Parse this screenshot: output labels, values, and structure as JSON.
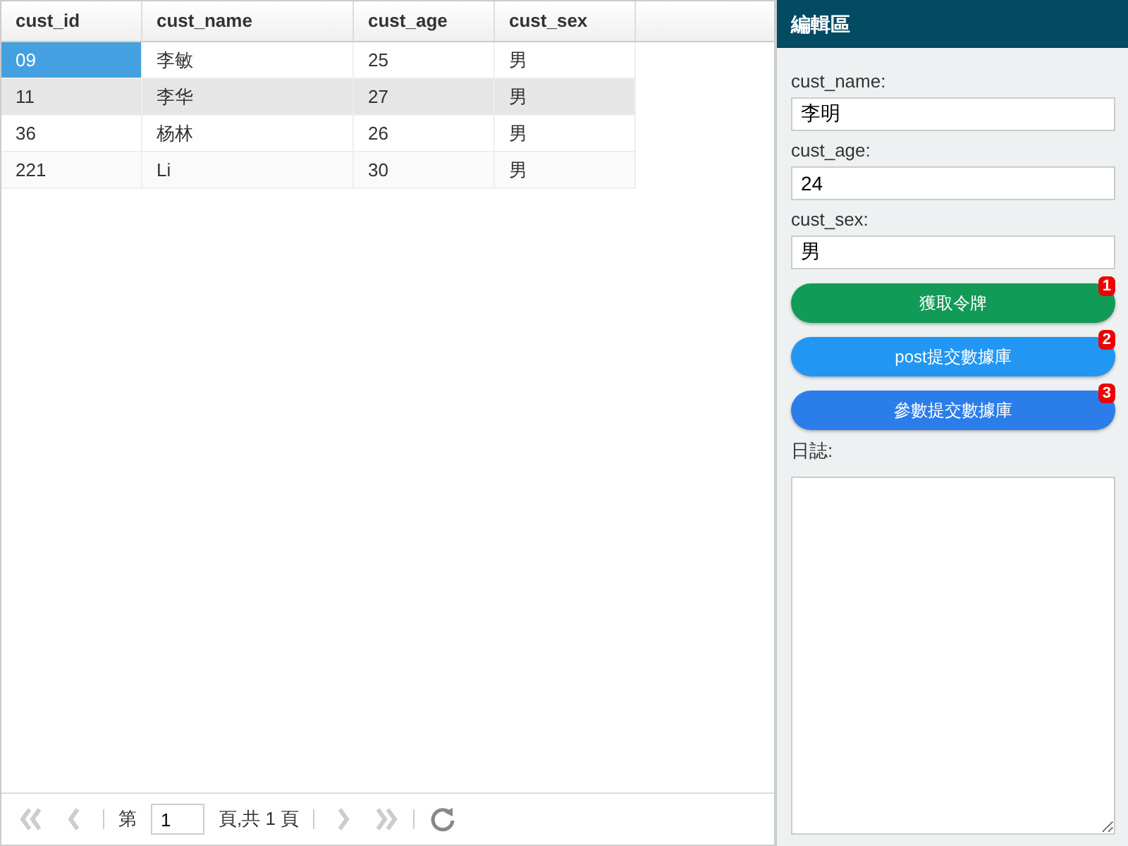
{
  "table": {
    "columns": [
      "cust_id",
      "cust_name",
      "cust_age",
      "cust_sex"
    ],
    "rows": [
      {
        "highlighted": false,
        "cells": [
          {
            "text": "09",
            "selected": true
          },
          {
            "text": "李敏",
            "selected": false
          },
          {
            "text": "25",
            "selected": false
          },
          {
            "text": "男",
            "selected": false
          }
        ]
      },
      {
        "highlighted": true,
        "cells": [
          {
            "text": "11",
            "selected": false
          },
          {
            "text": "李华",
            "selected": false
          },
          {
            "text": "27",
            "selected": false
          },
          {
            "text": "男",
            "selected": false
          }
        ]
      },
      {
        "highlighted": false,
        "cells": [
          {
            "text": "36",
            "selected": false
          },
          {
            "text": "杨林",
            "selected": false
          },
          {
            "text": "26",
            "selected": false
          },
          {
            "text": "男",
            "selected": false
          }
        ]
      },
      {
        "highlighted": false,
        "cells": [
          {
            "text": "221",
            "selected": false
          },
          {
            "text": "Li",
            "selected": false
          },
          {
            "text": "30",
            "selected": false
          },
          {
            "text": "男",
            "selected": false
          }
        ]
      }
    ]
  },
  "pager": {
    "first_disabled": true,
    "prev_disabled": true,
    "page_label": "第",
    "page_value": "1",
    "total_label": "頁,共 1 頁",
    "next_disabled": true,
    "last_disabled": true
  },
  "editor": {
    "title": "編輯區",
    "fields": [
      {
        "label": "cust_name:",
        "value": "李明"
      },
      {
        "label": "cust_age:",
        "value": "24"
      },
      {
        "label": "cust_sex:",
        "value": "男"
      }
    ],
    "buttons": [
      {
        "label": "獲取令牌",
        "badge": "1",
        "color": "#129b56"
      },
      {
        "label": "post提交數據庫",
        "badge": "2",
        "color": "#2196f3"
      },
      {
        "label": "參數提交數據庫",
        "badge": "3",
        "color": "#2b7de9"
      }
    ],
    "log_label": "日誌:"
  }
}
